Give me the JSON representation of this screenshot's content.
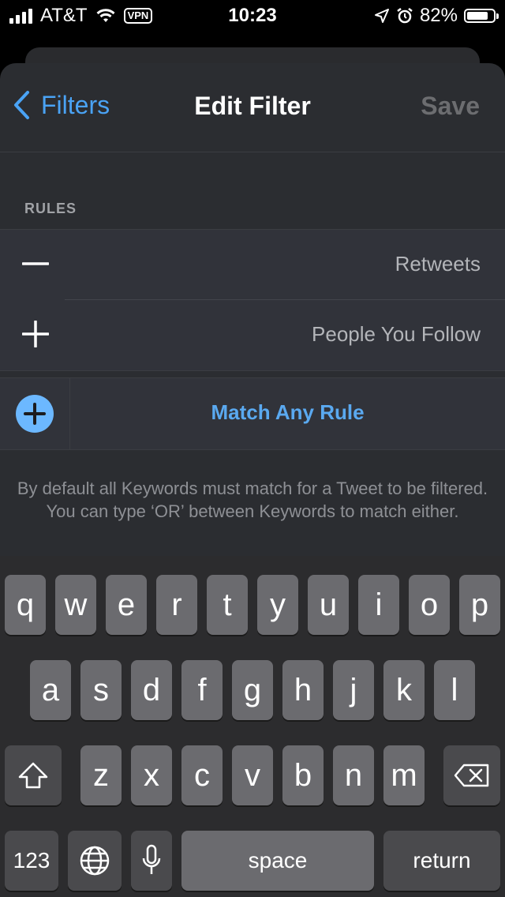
{
  "status_bar": {
    "carrier": "AT&T",
    "vpn": "VPN",
    "time": "10:23",
    "battery": "82%",
    "battery_level": 0.82
  },
  "nav": {
    "back_label": "Filters",
    "title": "Edit Filter",
    "save_label": "Save"
  },
  "rules_section": {
    "label": "RULES",
    "rules": [
      {
        "sign": "minus",
        "label": "Retweets"
      },
      {
        "sign": "plus",
        "label": "People You Follow"
      }
    ]
  },
  "match": {
    "label": "Match Any Rule"
  },
  "footnote": "By default all Keywords must match for a Tweet to be filtered. You can type ‘OR’ between Keywords to match either.",
  "keyboard": {
    "row1": [
      "q",
      "w",
      "e",
      "r",
      "t",
      "y",
      "u",
      "i",
      "o",
      "p"
    ],
    "row2": [
      "a",
      "s",
      "d",
      "f",
      "g",
      "h",
      "j",
      "k",
      "l"
    ],
    "row3": [
      "z",
      "x",
      "c",
      "v",
      "b",
      "n",
      "m"
    ],
    "numbers_label": "123",
    "space_label": "space",
    "return_label": "return",
    "icons": [
      "shift-icon",
      "backspace-icon",
      "globe-icon",
      "microphone-icon"
    ]
  },
  "colors": {
    "accent": "#4aa3f5",
    "match_circle": "#6cb8ff",
    "sheet": "#2b2d31",
    "keyboard_bg": "#2c2c2e"
  }
}
